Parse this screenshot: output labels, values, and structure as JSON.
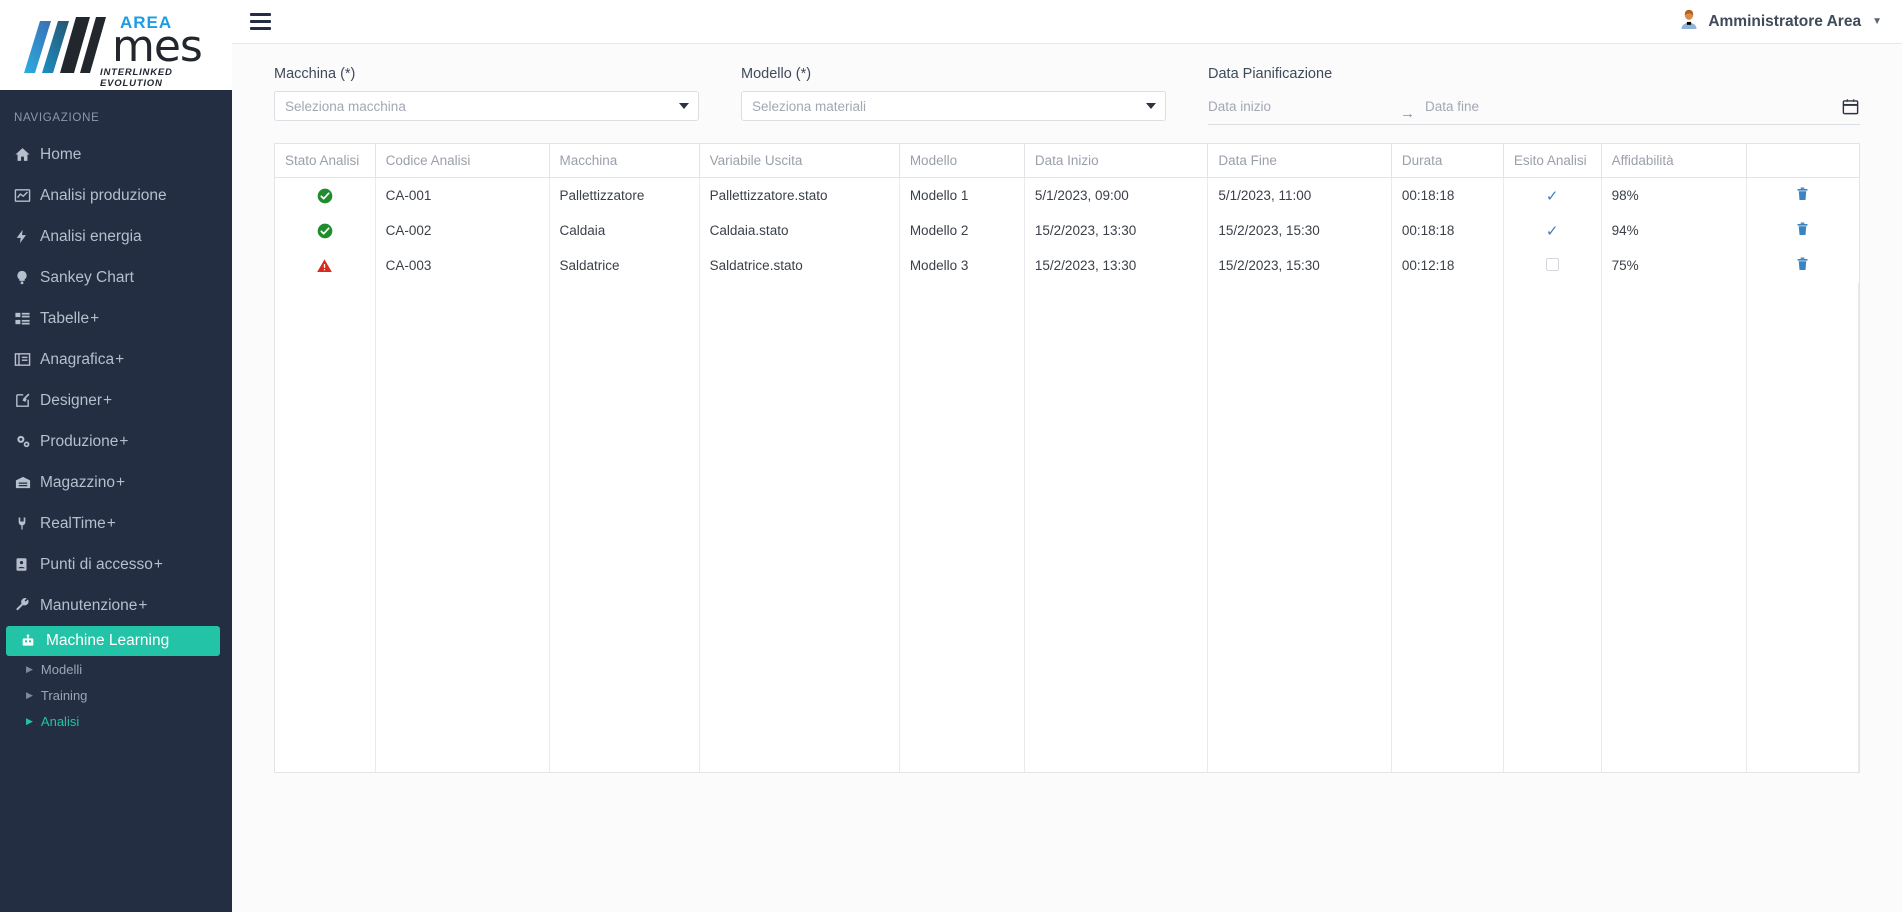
{
  "logo": {
    "area": "AREA",
    "mes": "mes",
    "tagline": "INTERLINKED EVOLUTION"
  },
  "sidebar": {
    "nav_header": "NAVIGAZIONE",
    "items": [
      {
        "label": "Home",
        "icon": "home-icon",
        "expandable": ""
      },
      {
        "label": "Analisi produzione",
        "icon": "chart-line-icon",
        "expandable": ""
      },
      {
        "label": "Analisi energia",
        "icon": "bolt-icon",
        "expandable": ""
      },
      {
        "label": "Sankey Chart",
        "icon": "lightbulb-icon",
        "expandable": ""
      },
      {
        "label": "Tabelle",
        "icon": "table-list-icon",
        "expandable": "+"
      },
      {
        "label": "Anagrafica",
        "icon": "id-card-icon",
        "expandable": "+"
      },
      {
        "label": "Designer",
        "icon": "pen-square-icon",
        "expandable": "+"
      },
      {
        "label": "Produzione",
        "icon": "gears-icon",
        "expandable": "+"
      },
      {
        "label": "Magazzino",
        "icon": "warehouse-icon",
        "expandable": "+"
      },
      {
        "label": "RealTime",
        "icon": "plug-icon",
        "expandable": "+"
      },
      {
        "label": "Punti di accesso",
        "icon": "badge-icon",
        "expandable": "+"
      },
      {
        "label": "Manutenzione",
        "icon": "wrench-icon",
        "expandable": "+"
      }
    ],
    "active_item": {
      "label": "Machine Learning",
      "icon": "robot-icon"
    },
    "sub_items": [
      {
        "label": "Modelli",
        "active": false
      },
      {
        "label": "Training",
        "active": false
      },
      {
        "label": "Analisi",
        "active": true
      }
    ],
    "accent_color": "#22c3a6",
    "background_color": "#242e42"
  },
  "topbar": {
    "menu_icon": "hamburger-icon",
    "user_name": "Amministratore Area",
    "user_icon": "user-avatar-icon",
    "caret_icon": "chevron-down-icon"
  },
  "filters": {
    "machine": {
      "label": "Macchina (*)",
      "placeholder": "Seleziona macchina",
      "value": ""
    },
    "model": {
      "label": "Modello (*)",
      "placeholder": "Seleziona materiali",
      "value": ""
    },
    "date": {
      "label": "Data Pianificazione",
      "start_placeholder": "Data inizio",
      "start_value": "",
      "end_placeholder": "Data fine",
      "end_value": "",
      "separator_icon": "arrow-right-icon",
      "calendar_icon": "calendar-icon"
    }
  },
  "table": {
    "columns": [
      "Stato Analisi",
      "Codice Analisi",
      "Macchina",
      "Variabile Uscita",
      "Modello",
      "Data Inizio",
      "Data Fine",
      "Durata",
      "Esito Analisi",
      "Affidabilità",
      ""
    ],
    "rows": [
      {
        "stato": "success",
        "stato_icon": "check-circle-icon",
        "codice": "CA-001",
        "macchina": "Pallettizzatore",
        "variabile": "Pallettizzatore.stato",
        "modello": "Modello 1",
        "data_inizio": "5/1/2023, 09:00",
        "data_fine": "5/1/2023, 11:00",
        "durata": "00:18:18",
        "esito": true,
        "affidabilita": "98%",
        "action_icon": "trash-icon"
      },
      {
        "stato": "success",
        "stato_icon": "check-circle-icon",
        "codice": "CA-002",
        "macchina": "Caldaia",
        "variabile": "Caldaia.stato",
        "modello": "Modello 2",
        "data_inizio": "15/2/2023, 13:30",
        "data_fine": "15/2/2023, 15:30",
        "durata": "00:18:18",
        "esito": true,
        "affidabilita": "94%",
        "action_icon": "trash-icon"
      },
      {
        "stato": "warning",
        "stato_icon": "warning-triangle-icon",
        "codice": "CA-003",
        "macchina": "Saldatrice",
        "variabile": "Saldatrice.stato",
        "modello": "Modello 3",
        "data_inizio": "15/2/2023, 13:30",
        "data_fine": "15/2/2023, 15:30",
        "durata": "00:12:18",
        "esito": false,
        "affidabilita": "75%",
        "action_icon": "trash-icon"
      }
    ],
    "colors": {
      "success": "#1f8c2e",
      "warning": "#d82b20",
      "check": "#3f7fbf",
      "trash": "#3b84c4"
    }
  }
}
